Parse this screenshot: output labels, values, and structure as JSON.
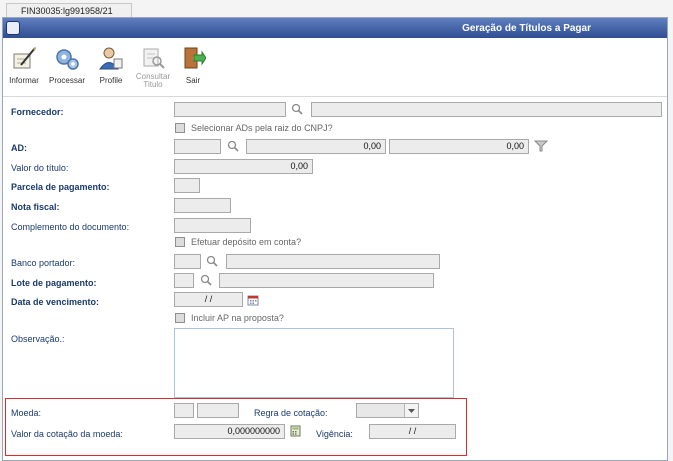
{
  "tab": {
    "label": "FIN30035:lg991958/21"
  },
  "window": {
    "title": "Geração de Títulos a Pagar"
  },
  "toolbar": {
    "informar": "Informar",
    "processar": "Processar",
    "profile": "Profile",
    "consultar_line1": "Consultar",
    "consultar_line2": "Titulo",
    "sair": "Sair"
  },
  "form": {
    "fornecedor": {
      "label": "Fornecedor:"
    },
    "selecionar_ads": {
      "label": "Selecionar ADs pela raiz do CNPJ?"
    },
    "ad": {
      "label": "AD:",
      "value1": "0,00",
      "value2": "0,00"
    },
    "valor_titulo": {
      "label": "Valor do título:",
      "value": "0,00"
    },
    "parcela": {
      "label": "Parcela de pagamento:"
    },
    "nota_fiscal": {
      "label": "Nota fiscal:"
    },
    "complemento": {
      "label": "Complemento do documento:"
    },
    "efetuar_deposito": {
      "label": "Efetuar depósito em conta?"
    },
    "banco_portador": {
      "label": "Banco portador:"
    },
    "lote_pagamento": {
      "label": "Lote de pagamento:"
    },
    "data_vencimento": {
      "label": "Data de vencimento:",
      "value": "/ /"
    },
    "incluir_ap": {
      "label": "Incluir AP na proposta?"
    },
    "observacao": {
      "label": "Observação.:"
    },
    "moeda": {
      "label": "Moeda:"
    },
    "regra_cotacao": {
      "label": "Regra de cotação:"
    },
    "valor_cotacao": {
      "label": "Valor da cotação da moeda:",
      "value": "0,000000000"
    },
    "vigencia": {
      "label": "Vigência:",
      "value": "/ /"
    }
  },
  "colors": {
    "title_bar": "#2f4e93",
    "label": "#1a3a6e",
    "highlight_box": "#e02b2b"
  }
}
